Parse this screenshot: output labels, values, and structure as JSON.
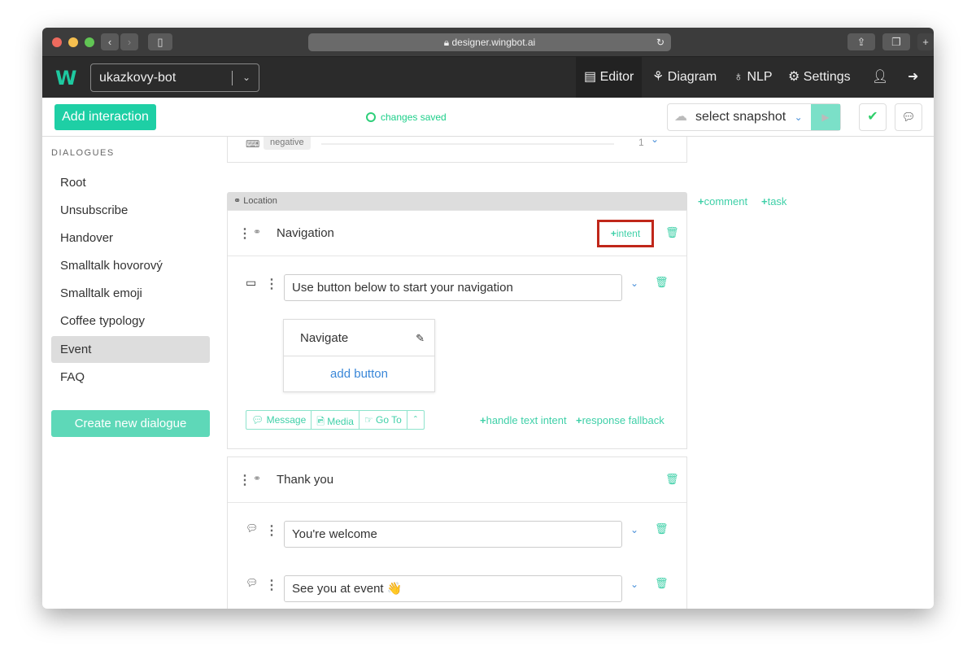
{
  "browser": {
    "url": "designer.wingbot.ai"
  },
  "app": {
    "logo": "W",
    "bot_name": "ukazkovy-bot",
    "nav": [
      {
        "label": "Editor",
        "icon": "editor-icon",
        "active": true
      },
      {
        "label": "Diagram",
        "icon": "sitemap-icon"
      },
      {
        "label": "NLP",
        "icon": "lightbulb-icon"
      },
      {
        "label": "Settings",
        "icon": "gears-icon"
      }
    ]
  },
  "toolbar": {
    "add_interaction": "Add interaction",
    "status": "changes saved",
    "snapshot": "select snapshot"
  },
  "sidebar": {
    "heading": "DIALOGUES",
    "items": [
      "Root",
      "Unsubscribe",
      "Handover",
      "Smalltalk hovorový",
      "Smalltalk emoji",
      "Coffee typology",
      "Event",
      "FAQ"
    ],
    "active": "Event",
    "create": "Create new dialogue"
  },
  "main": {
    "prev": {
      "tag": "negative",
      "count": "1"
    },
    "section": "Location",
    "interaction1": {
      "title": "Navigation",
      "intent": "intent",
      "message": "Use button below to start your navigation",
      "button": "Navigate",
      "add_button": "add button",
      "actions": [
        "Message",
        "Media",
        "Go To"
      ],
      "handle": "handle text intent",
      "fallback": "response fallback"
    },
    "interaction2": {
      "title": "Thank you",
      "messages": [
        "You're welcome",
        "See you at event 👋"
      ]
    }
  },
  "right": {
    "comment": "comment",
    "task": "task"
  },
  "colors": {
    "accent": "#1ecfa5",
    "highlight": "#c0271a"
  }
}
